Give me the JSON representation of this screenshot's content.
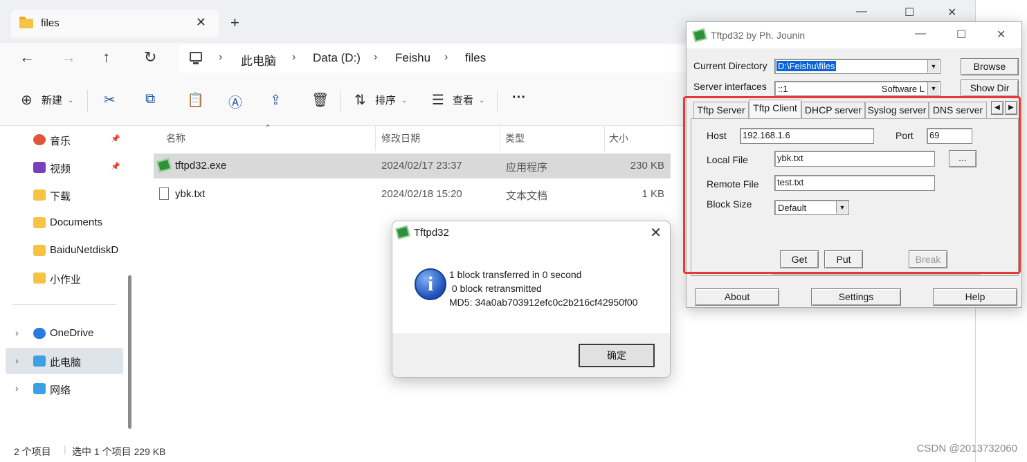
{
  "explorer": {
    "tab_title": "files",
    "tab_close": "✕",
    "new_tab": "+",
    "window_controls": {
      "minimize": "—",
      "maximize": "☐",
      "close": "✕"
    },
    "nav": {
      "back": "←",
      "forward": "→",
      "up": "↑",
      "refresh": "↻"
    },
    "breadcrumb": [
      "此电脑",
      "Data (D:)",
      "Feishu",
      "files"
    ],
    "breadcrumb_sep": "›",
    "toolbar": {
      "new_label": "新建",
      "sort_label": "排序",
      "view_label": "查看",
      "more_label": "···"
    },
    "sidebar": {
      "quick_items": [
        {
          "label": "音乐",
          "pinned": true
        },
        {
          "label": "视频",
          "pinned": true
        },
        {
          "label": "下载"
        },
        {
          "label": "Documents"
        },
        {
          "label": "BaiduNetdiskD"
        },
        {
          "label": "小作业"
        }
      ],
      "tree_items": [
        {
          "label": "OneDrive"
        },
        {
          "label": "此电脑",
          "selected": true
        },
        {
          "label": "网络"
        }
      ]
    },
    "columns": [
      "名称",
      "修改日期",
      "类型",
      "大小"
    ],
    "files": [
      {
        "name": "tftpd32.exe",
        "modified": "2024/02/17 23:37",
        "type": "应用程序",
        "size": "230 KB",
        "selected": true
      },
      {
        "name": "ybk.txt",
        "modified": "2024/02/18 15:20",
        "type": "文本文档",
        "size": "1 KB"
      }
    ],
    "status": {
      "count": "2 个项目",
      "selection": "选中 1 个项目  229 KB"
    }
  },
  "msgbox": {
    "title": "Tftpd32",
    "close": "✕",
    "icon": "info-icon",
    "lines": [
      "1 block transferred in 0 second",
      " 0 block retransmitted",
      "MD5: 34a0ab703912efc0c2b216cf42950f00"
    ],
    "ok_label": "确定"
  },
  "tftpd": {
    "title": "Tftpd32 by Ph. Jounin",
    "window_controls": {
      "minimize": "—",
      "maximize": "☐",
      "close": "✕"
    },
    "current_directory_label": "Current Directory",
    "current_directory": "D:\\Feishu\\files",
    "browse_label": "Browse",
    "server_interfaces_label": "Server interfaces",
    "server_interface": "::1",
    "server_interface_desc": "Software L",
    "show_dir_label": "Show Dir",
    "tabs": [
      "Tftp Server",
      "Tftp Client",
      "DHCP server",
      "Syslog server",
      "DNS server"
    ],
    "active_tab": "Tftp Client",
    "client": {
      "host_label": "Host",
      "host": "192.168.1.6",
      "port_label": "Port",
      "port": "69",
      "local_file_label": "Local File",
      "local_file": "ybk.txt",
      "browse_dots": "...",
      "remote_file_label": "Remote File",
      "remote_file": "test.txt",
      "block_size_label": "Block Size",
      "block_size": "Default",
      "get_label": "Get",
      "put_label": "Put",
      "break_label": "Break"
    },
    "bottom_buttons": {
      "about": "About",
      "settings": "Settings",
      "help": "Help"
    }
  },
  "watermark": "CSDN @2013732060",
  "accent_color": "#e53935"
}
